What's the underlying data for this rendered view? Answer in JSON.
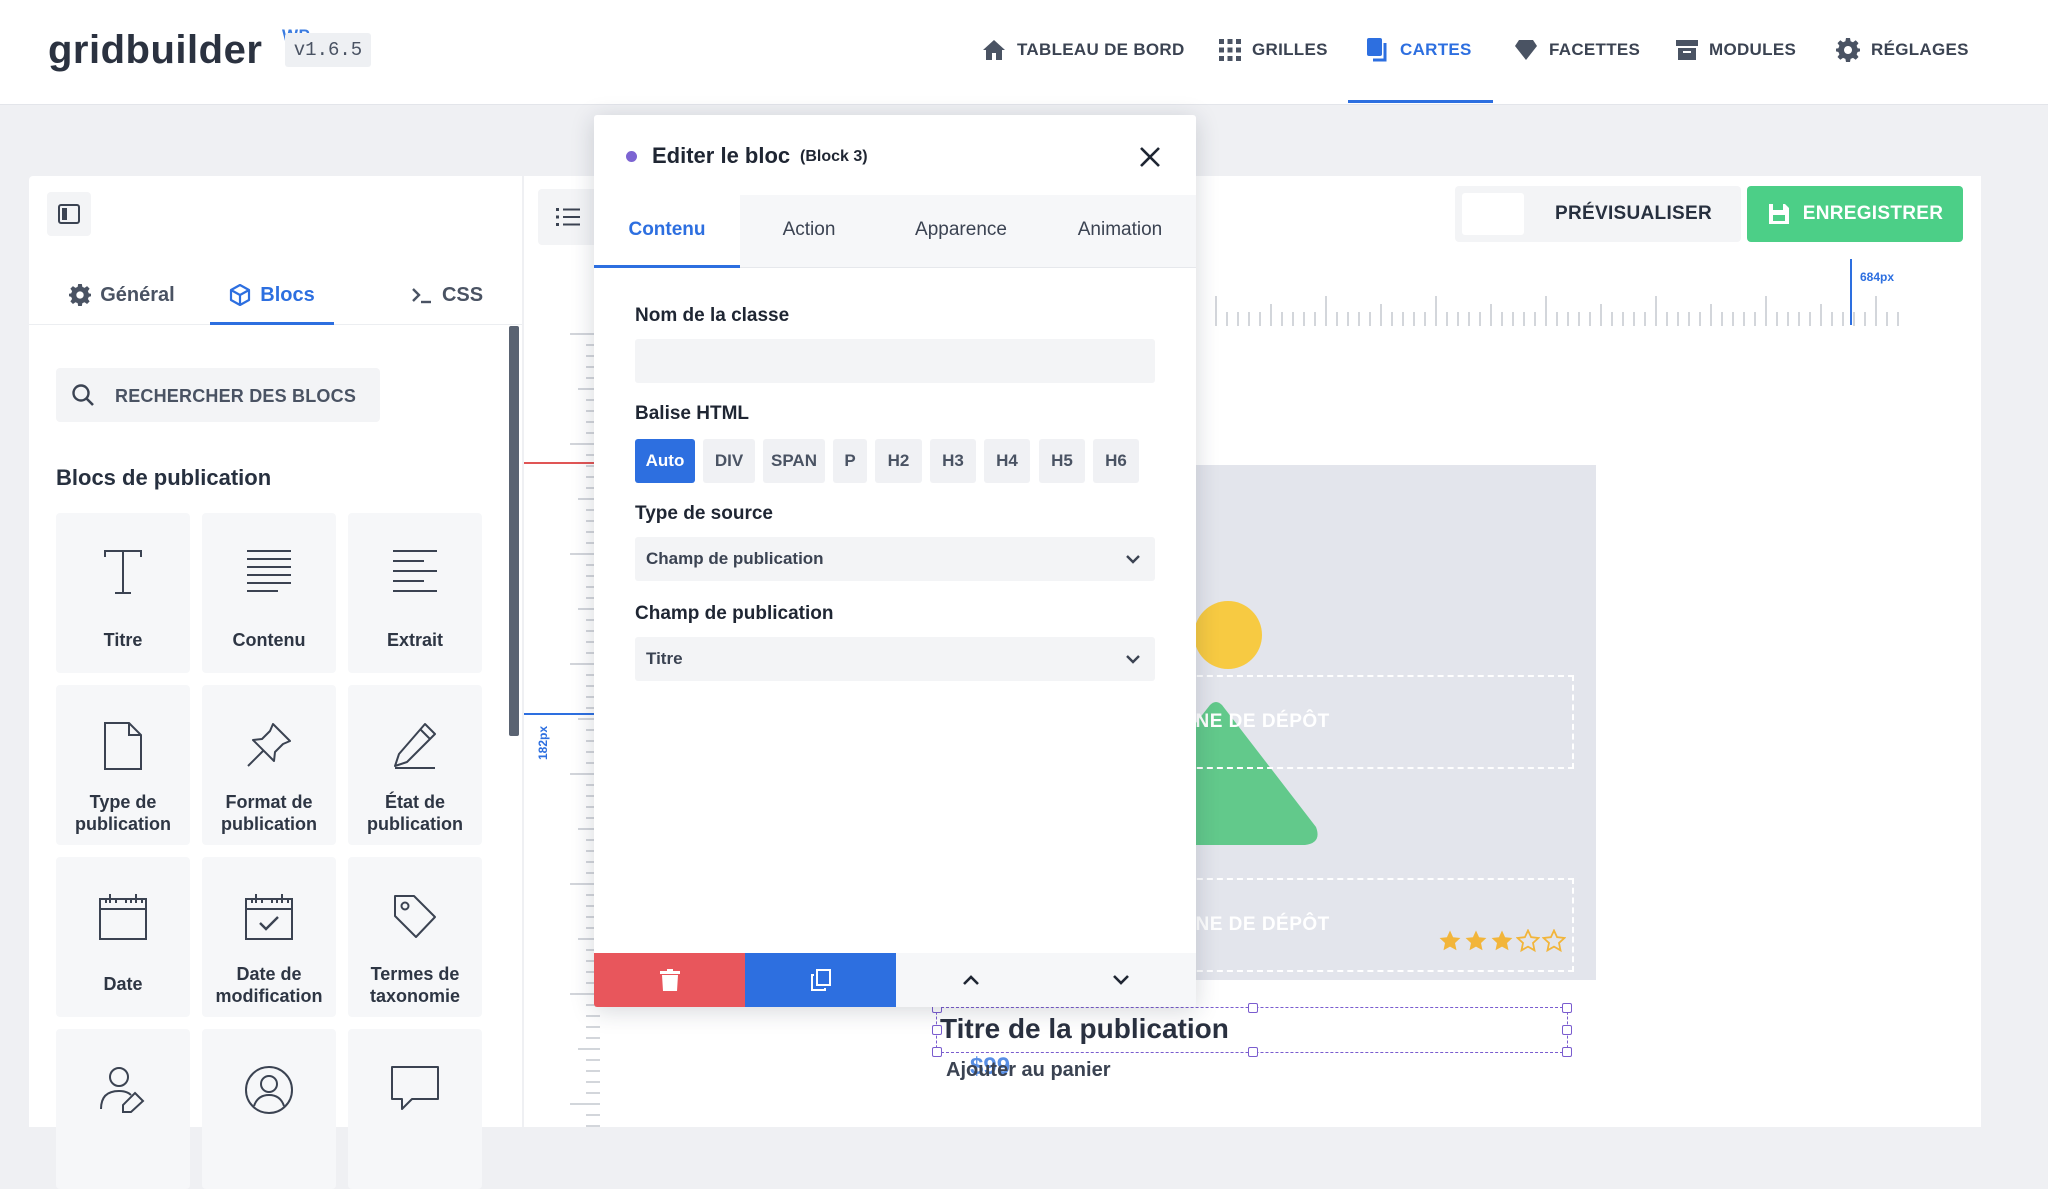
{
  "brand": {
    "name": "gridbuilder",
    "suffix": "WP",
    "version": "v1.6.5"
  },
  "nav": [
    {
      "label": "Tableau de bord",
      "icon": "home-icon"
    },
    {
      "label": "Grilles",
      "icon": "grid-icon"
    },
    {
      "label": "Cartes",
      "icon": "cards-icon",
      "active": true
    },
    {
      "label": "Facettes",
      "icon": "gem-icon"
    },
    {
      "label": "Modules",
      "icon": "archive-icon"
    },
    {
      "label": "Réglages",
      "icon": "gear-icon"
    }
  ],
  "left_panel": {
    "tabs": [
      {
        "label": "Général",
        "icon": "gear-icon"
      },
      {
        "label": "Blocs",
        "icon": "cube-icon",
        "active": true
      },
      {
        "label": "CSS",
        "icon": "terminal-icon"
      }
    ],
    "search_placeholder": "Rechercher des blocs",
    "section_title": "Blocs de publication",
    "blocks": [
      {
        "label": "Titre",
        "icon": "title-icon"
      },
      {
        "label": "Contenu",
        "icon": "content-icon"
      },
      {
        "label": "Extrait",
        "icon": "excerpt-icon"
      },
      {
        "label": "Type de publication",
        "icon": "file-icon"
      },
      {
        "label": "Format de publication",
        "icon": "pin-icon"
      },
      {
        "label": "État de publication",
        "icon": "pencil-icon"
      },
      {
        "label": "Date",
        "icon": "calendar-icon"
      },
      {
        "label": "Date de modification",
        "icon": "calendar-check-icon"
      },
      {
        "label": "Termes de taxonomie",
        "icon": "tag-icon"
      },
      {
        "label": "",
        "icon": "user-edit-icon"
      },
      {
        "label": "",
        "icon": "user-circle-icon"
      },
      {
        "label": "",
        "icon": "comment-icon"
      }
    ]
  },
  "toolbar": {
    "preview_label": "Prévisualiser",
    "save_label": "Enregistrer"
  },
  "rulers": {
    "vertical_label": "182px",
    "horizontal_label": "684px"
  },
  "card_preview": {
    "dropzone_top": "ONE DE DÉPÔT",
    "dropzone_bottom": "ONE DE DÉPÔT",
    "rating": 3,
    "rating_max": 5,
    "title": "Titre de la publication",
    "price": "$99",
    "cart_label": "Ajouter au panier"
  },
  "modal": {
    "title": "Editer le bloc",
    "subtitle": "(Block 3)",
    "tabs": [
      {
        "label": "Contenu",
        "active": true
      },
      {
        "label": "Action"
      },
      {
        "label": "Apparence"
      },
      {
        "label": "Animation"
      }
    ],
    "class_label": "Nom de la classe",
    "class_value": "",
    "html_tag_label": "Balise HTML",
    "html_tags": [
      "Auto",
      "DIV",
      "SPAN",
      "P",
      "H2",
      "H3",
      "H4",
      "H5",
      "H6"
    ],
    "html_tag_selected": "Auto",
    "source_label": "Type de source",
    "source_value": "Champ de publication",
    "field_label": "Champ de publication",
    "field_value": "Titre"
  },
  "colors": {
    "accent": "#2d6fe0",
    "save": "#4ccf87",
    "delete": "#e8565c",
    "star": "#f2b53a",
    "sun": "#f7ca42",
    "mountain": "#62c98b"
  }
}
